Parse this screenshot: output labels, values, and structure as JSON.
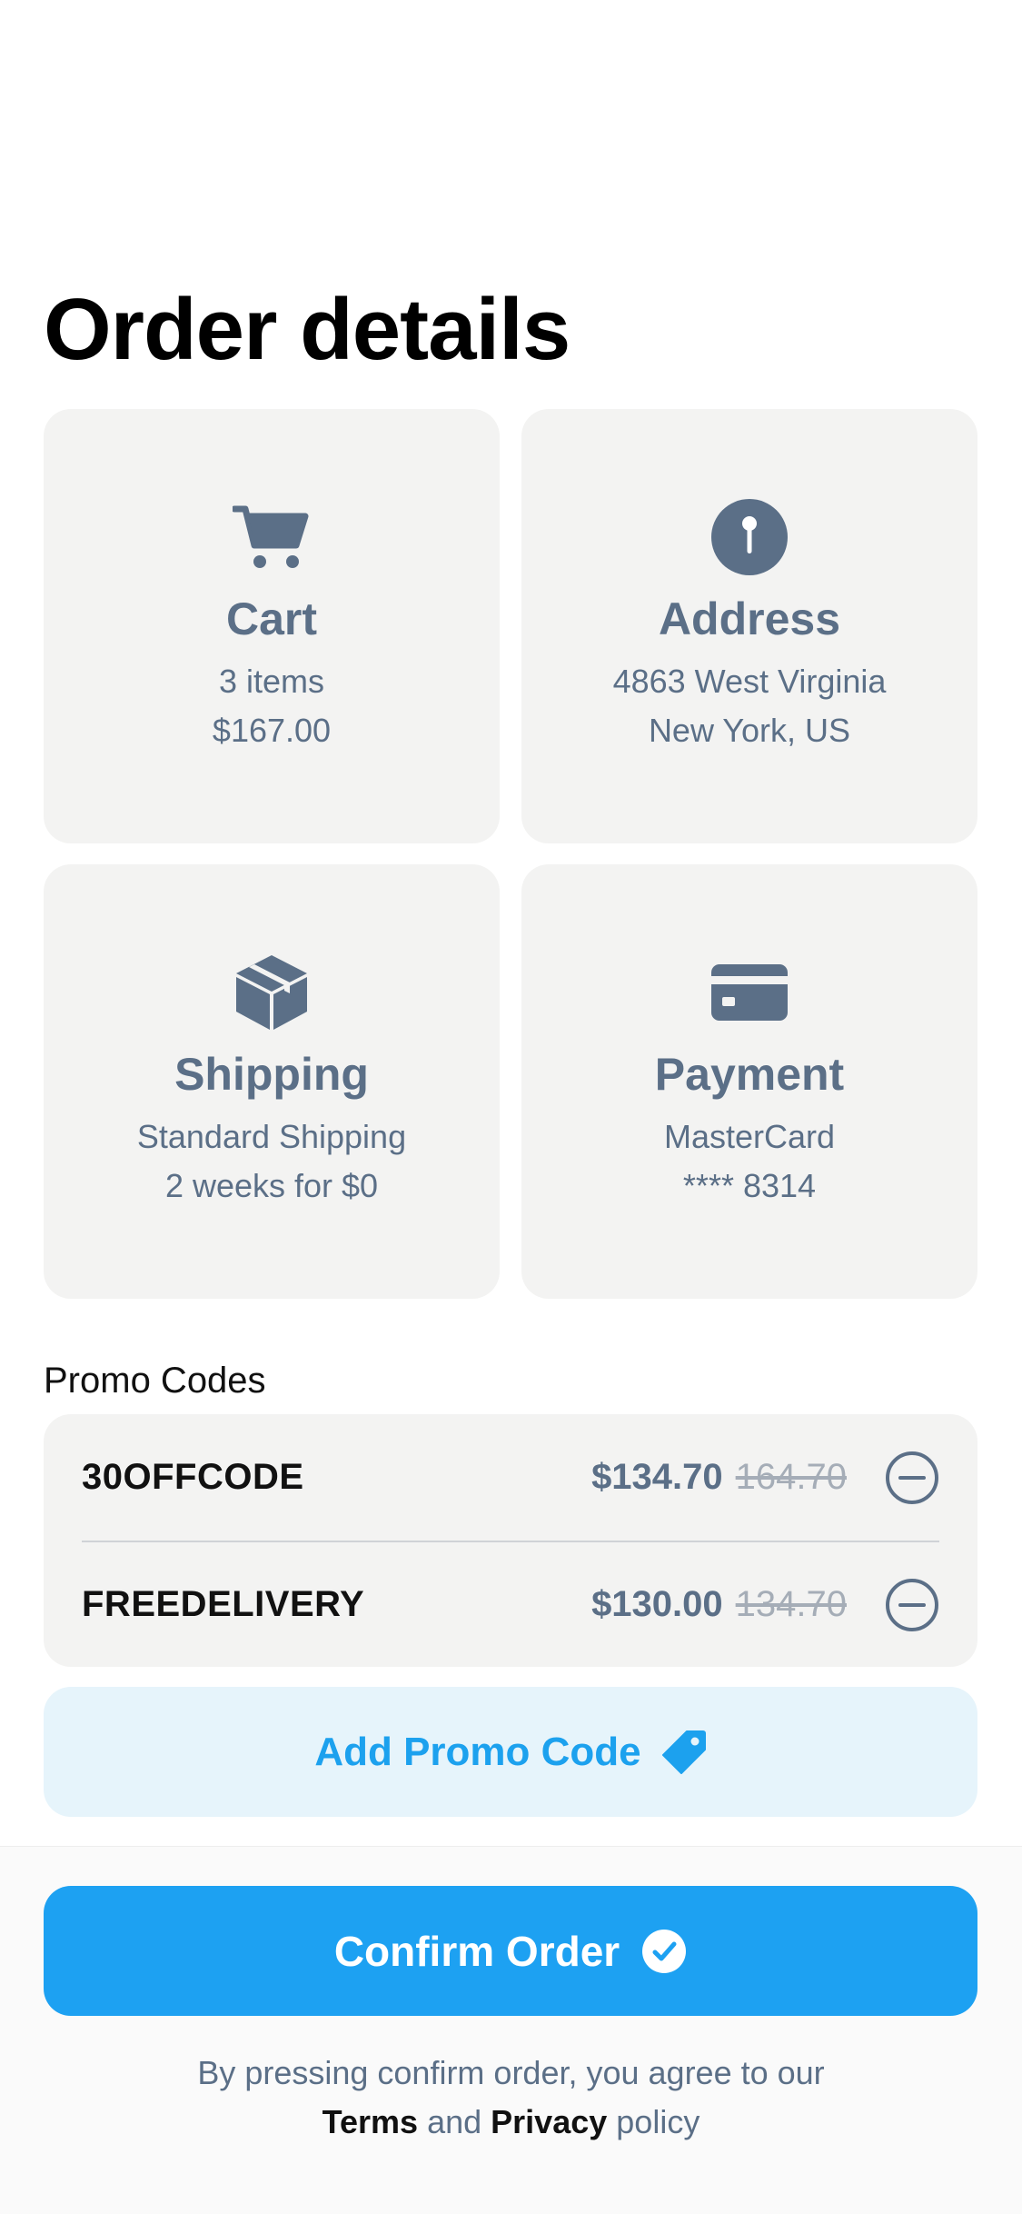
{
  "page": {
    "title": "Order details"
  },
  "cards": {
    "cart": {
      "title": "Cart",
      "line1": "3 items",
      "line2": "$167.00",
      "icon": "cart-icon"
    },
    "address": {
      "title": "Address",
      "line1": "4863 West Virginia",
      "line2": "New York, US",
      "icon": "location-pin-icon"
    },
    "shipping": {
      "title": "Shipping",
      "line1": "Standard Shipping",
      "line2": "2 weeks for $0",
      "icon": "box-icon"
    },
    "payment": {
      "title": "Payment",
      "line1": "MasterCard",
      "line2": "**** 8314",
      "icon": "credit-card-icon"
    }
  },
  "promo": {
    "section_label": "Promo Codes",
    "codes": [
      {
        "code": "30OFFCODE",
        "new_price": "$134.70",
        "old_price": "164.70"
      },
      {
        "code": "FREEDELIVERY",
        "new_price": "$130.00",
        "old_price": "134.70"
      }
    ],
    "add_label": "Add Promo Code"
  },
  "footer": {
    "confirm_label": "Confirm Order",
    "legal_line1": "By pressing confirm order, you agree to our",
    "terms_label": "Terms",
    "and_text": "and",
    "privacy_label": "Privacy",
    "policy_text": "policy"
  },
  "colors": {
    "accent": "#1da1f2",
    "card_bg": "#f3f3f2",
    "icon_slate": "#5b6f87",
    "promo_bg": "#e6f4fb"
  }
}
